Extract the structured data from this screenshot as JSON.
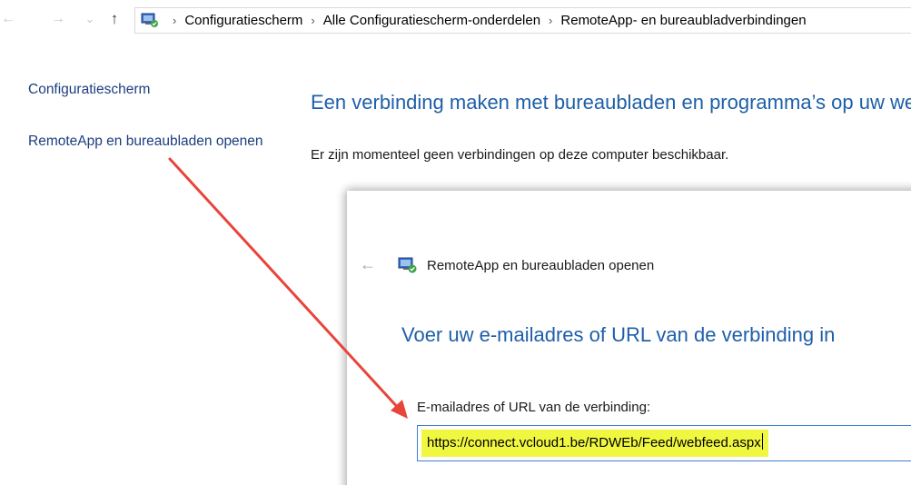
{
  "address_bar": {
    "back_glyph": "←",
    "forward_glyph": "→",
    "recent_glyph": "⌄",
    "up_glyph": "↑",
    "icon": "control-panel-icon",
    "breadcrumbs": [
      "Configuratiescherm",
      "Alle Configuratiescherm-onderdelen",
      "RemoteApp- en bureaubladverbindingen"
    ],
    "separator": "›"
  },
  "left_pane": {
    "home_link": "Configuratiescherm",
    "open_link": "RemoteApp en bureaubladen openen"
  },
  "main": {
    "title": "Een verbinding maken met bureaubladen en programma’s op uw werkplek",
    "status_text": "Er zijn momenteel geen verbindingen op deze computer beschikbaar."
  },
  "dialog": {
    "back_glyph": "←",
    "icon": "remoteapp-icon",
    "title": "RemoteApp en bureaubladen openen",
    "heading": "Voer uw e-mailadres of URL van de verbinding in",
    "field_label": "E-mailadres of URL van de verbinding:",
    "field_value": "https://connect.vcloud1.be/RDWEb/Feed/webfeed.aspx"
  },
  "colors": {
    "link": "#1c3e7f",
    "heading": "#1e5fa8",
    "highlight": "#f0f740",
    "arrow": "#e8443a",
    "input_border": "#3f7fd0"
  }
}
